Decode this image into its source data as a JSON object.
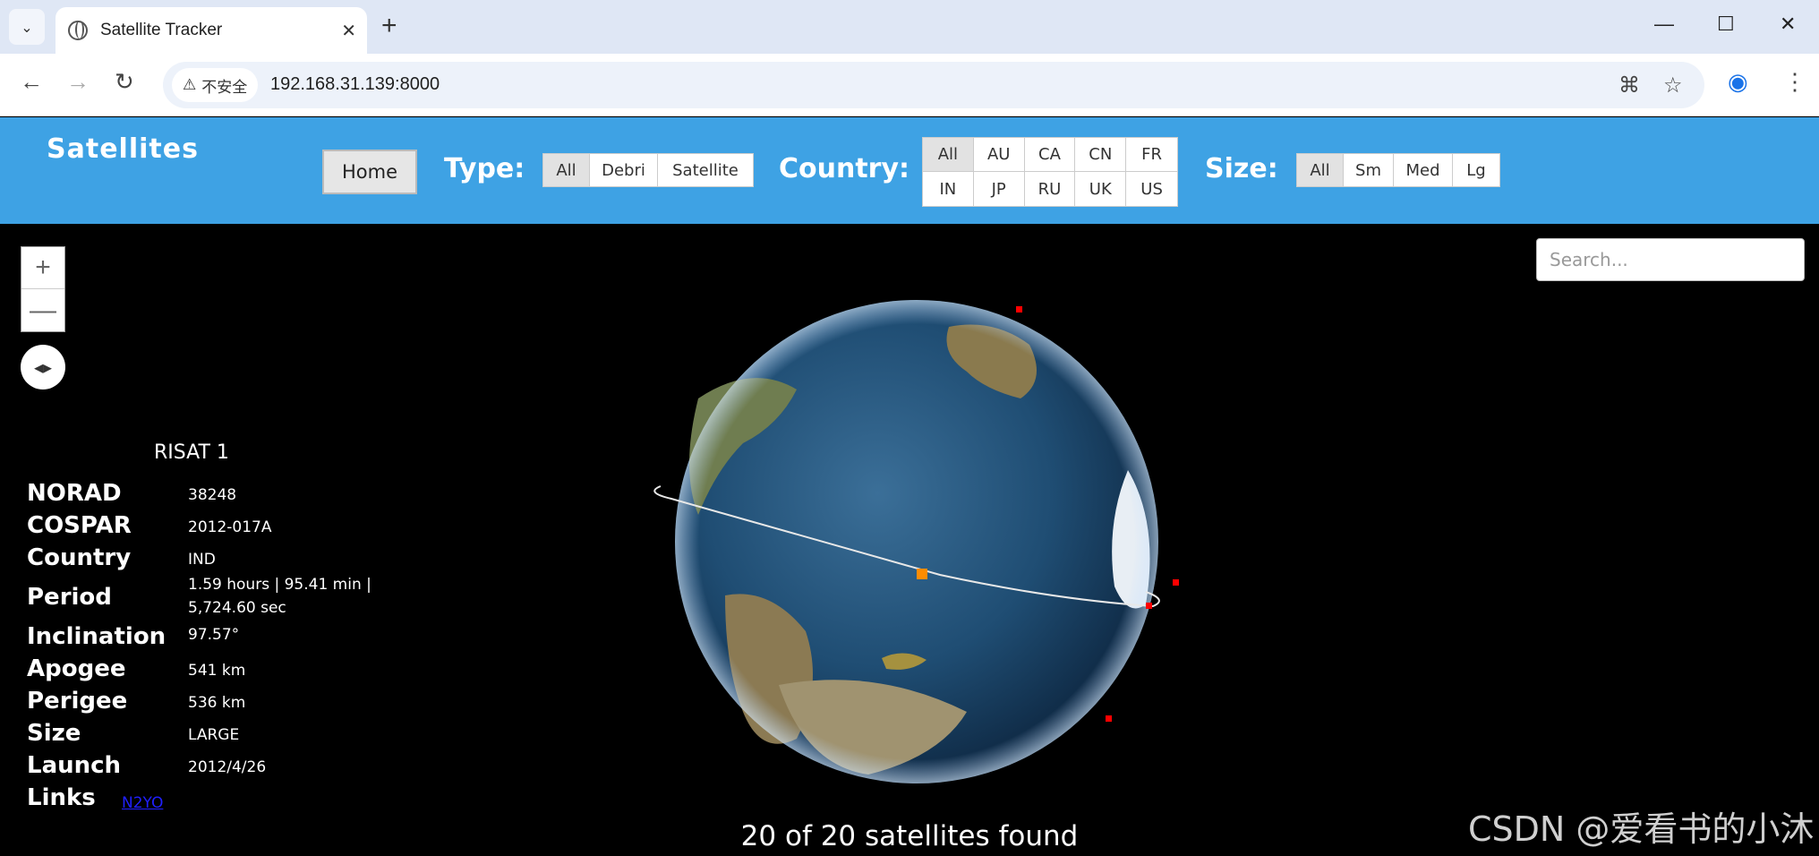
{
  "browser": {
    "tab_title": "Satellite Tracker",
    "security_label": "不安全",
    "url": "192.168.31.139:8000"
  },
  "app": {
    "brand": "Satellites",
    "home_label": "Home",
    "type_label": "Type:",
    "type_options": [
      "All",
      "Debri",
      "Satellite"
    ],
    "country_label": "Country:",
    "country_options": [
      "All",
      "AU",
      "CA",
      "CN",
      "FR",
      "IN",
      "JP",
      "RU",
      "UK",
      "US"
    ],
    "size_label": "Size:",
    "size_options": [
      "All",
      "Sm",
      "Med",
      "Lg"
    ],
    "active": {
      "type": "All",
      "country": "All",
      "size": "All"
    }
  },
  "map": {
    "zoom_in": "+",
    "zoom_out": "—",
    "search_placeholder": "Search...",
    "found_text": "20 of 20 satellites found"
  },
  "satellite": {
    "name": "RISAT 1",
    "fields": [
      {
        "key": "NORAD",
        "value": "38248"
      },
      {
        "key": "COSPAR",
        "value": "2012-017A"
      },
      {
        "key": "Country",
        "value": "IND"
      },
      {
        "key": "Period",
        "value": "1.59 hours | 95.41 min | 5,724.60 sec"
      },
      {
        "key": "Inclination",
        "value": "97.57°"
      },
      {
        "key": "Apogee",
        "value": "541 km"
      },
      {
        "key": "Perigee",
        "value": "536 km"
      },
      {
        "key": "Size",
        "value": "LARGE"
      },
      {
        "key": "Launch",
        "value": "2012/4/26"
      }
    ],
    "links_label": "Links",
    "link_text": "N2YO"
  },
  "watermark": "CSDN @爱看书的小沐",
  "colors": {
    "header": "#3ea2e4",
    "satellite": "#ff0000",
    "selected": "#ff8c00"
  }
}
